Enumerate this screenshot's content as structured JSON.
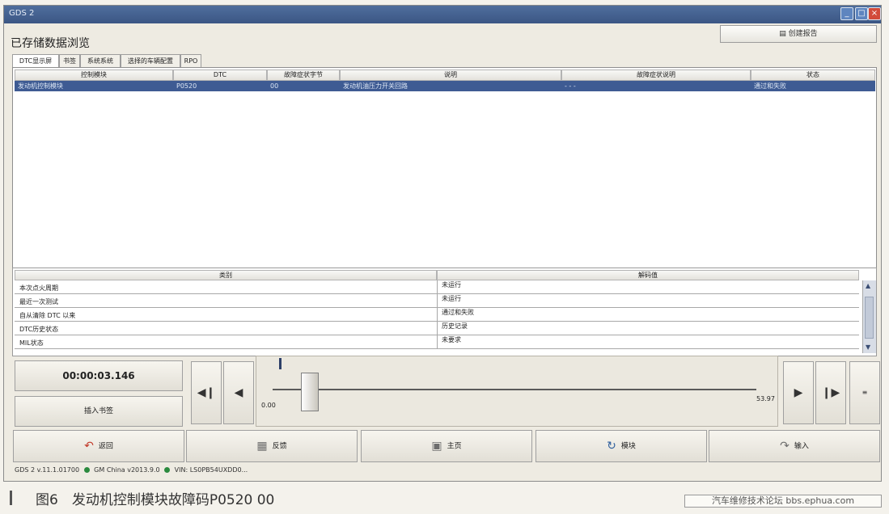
{
  "window": {
    "title": "GDS 2",
    "heading": "已存储数据浏览",
    "report_button": "创建报告"
  },
  "tabs": [
    "DTC显示屏",
    "书签",
    "系统系统",
    "选择的车辆配置",
    "RPO"
  ],
  "dtc_table": {
    "columns": [
      "控制模块",
      "DTC",
      "故障症状字节",
      "说明",
      "故障症状说明",
      "状态"
    ],
    "rows": [
      {
        "module": "发动机控制模块",
        "dtc": "P0520",
        "byte": "00",
        "desc": "发动机油压力开关回路",
        "symptom_desc": "- - -",
        "status": "通过和失败"
      }
    ]
  },
  "detail_table": {
    "columns": [
      "类别",
      "解码值"
    ],
    "rows": [
      {
        "category": "本次点火周期",
        "value": "未运行"
      },
      {
        "category": "最近一次测试",
        "value": "未运行"
      },
      {
        "category": "自从清除 DTC 以来",
        "value": "通过和失败"
      },
      {
        "category": "DTC历史状态",
        "value": "历史记录"
      },
      {
        "category": "MIL状态",
        "value": "未要求"
      }
    ]
  },
  "playback": {
    "timer": "00:00:03.146",
    "insert_bookmark": "插入书签",
    "slider_min": "0.00",
    "slider_max": "53.97",
    "slider_position": 0.06
  },
  "nav": {
    "back": "返回",
    "feedback": "反馈",
    "home": "主页",
    "module": "模块",
    "input": "输入"
  },
  "statusbar": {
    "version": "GDS 2 v.11.1.01700",
    "china": "GM China v2013.9.0",
    "vin": "VIN: LS0PB54UXDD0..."
  },
  "caption": "图6　发动机控制模块故障码P0520 00",
  "watermark": "汽车维修技术论坛 bbs.ephua.com",
  "colors": {
    "selection": "#3e5b93",
    "titlebar": "#4f6e9d"
  }
}
